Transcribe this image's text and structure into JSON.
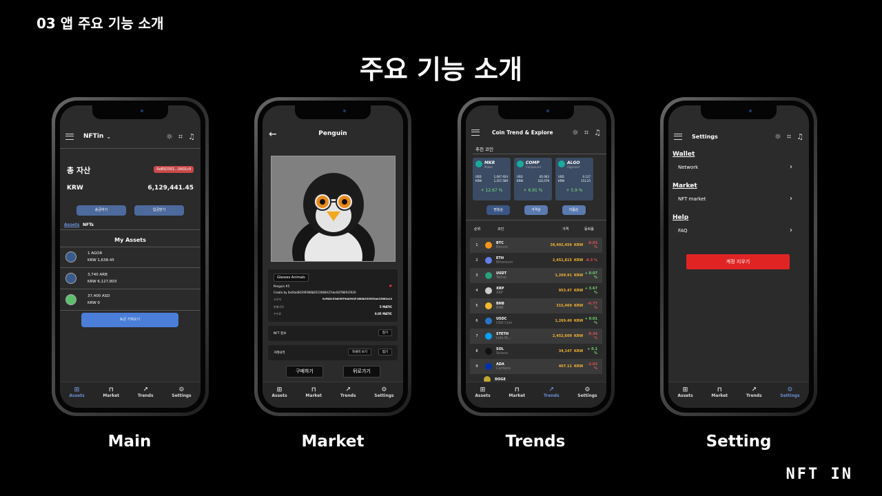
{
  "slide": {
    "section_title": "03 앱 주요 기능 소개",
    "title": "주요 기능 소개",
    "logo": "NFT IN"
  },
  "captions": [
    "Main",
    "Market",
    "Trends",
    "Setting"
  ],
  "tabs": [
    {
      "icon": "wallet-icon",
      "label": "Assets"
    },
    {
      "icon": "bag-icon",
      "label": "Market"
    },
    {
      "icon": "trend-icon",
      "label": "Trends"
    },
    {
      "icon": "gear-icon",
      "label": "Settings"
    }
  ],
  "main": {
    "app_name": "NFTin",
    "total_label": "총 자산",
    "address": "0xB5D301...0A01c9",
    "currency": "KRW",
    "total_value": "6,129,441.45",
    "send_btn": "송금하기",
    "receive_btn": "입금받기",
    "tab_assets": "Assets",
    "tab_nfts": "NFTs",
    "my_assets": "My Assets",
    "assets": [
      {
        "amount": "1 AGOR",
        "krw": "KRW 1,638.45",
        "color": "#3a5a8c"
      },
      {
        "amount": "3,740 ARB",
        "krw": "KRW 6,127,803",
        "color": "#3a5a8c"
      },
      {
        "amount": "37,400 ASD",
        "krw": "KRW 0",
        "color": "#5cbf6a"
      }
    ],
    "import_btn": "토큰 가져오기"
  },
  "market": {
    "title": "Penguin",
    "collection": "Glasses Animals",
    "token": "Penguin #5",
    "creator": "Create by 0x04a4E639F808bE5C0066A37ded3078E91F620",
    "owner_label": "소유자",
    "owner_value": "0xFAD153d059F9dA994F1688b333f3f1b415662a14",
    "price_label": "판매가격",
    "price_value": "5 MATIC",
    "fee_label": "수수료",
    "fee_value": "0.05 MATIC",
    "info_label": "NFT 정보",
    "fold": "접기",
    "history_label": "거래내역",
    "detail": "자세히 보기",
    "buy": "구매하기",
    "back": "뒤로가기"
  },
  "trends": {
    "title": "Coin Trend & Explore",
    "recommend": "추천 코인",
    "cards": [
      {
        "sym": "MKR",
        "name": "Maker",
        "usd": "1,047.924",
        "krw": "1,257,589",
        "chg": "+ 12.67 %"
      },
      {
        "sym": "COMP",
        "name": "Compound",
        "usd": "85.063",
        "krw": "102,076",
        "chg": "+ 6.91 %"
      },
      {
        "sym": "ALGO",
        "name": "Algorand",
        "usd": "0.127",
        "krw": "153.25",
        "chg": "+ 5.9 %"
      }
    ],
    "usd_label": "USD",
    "krw_label": "KRW",
    "sort": [
      "명칭순",
      "가격순",
      "이름순"
    ],
    "cols": [
      "순위",
      "코인",
      "가격",
      "등락률"
    ],
    "coins": [
      {
        "rank": "1",
        "sym": "BTC",
        "name": "Bitcoin",
        "price": "38,492,456",
        "chg": "-0.03 %",
        "up": false,
        "color": "#f7931a"
      },
      {
        "rank": "2",
        "sym": "ETH",
        "name": "Ethereum",
        "price": "2,451,815",
        "chg": "-0.3 %",
        "up": false,
        "color": "#627eea"
      },
      {
        "rank": "3",
        "sym": "USDT",
        "name": "Tether",
        "price": "1,269.91",
        "chg": "+ 0.07 %",
        "up": true,
        "color": "#26a17b"
      },
      {
        "rank": "4",
        "sym": "XRP",
        "name": "XRP",
        "price": "953.47",
        "chg": "+ 3.67 %",
        "up": true,
        "color": "#cccccc"
      },
      {
        "rank": "5",
        "sym": "BNB",
        "name": "BNB",
        "price": "315,469",
        "chg": "-0.77 %",
        "up": false,
        "color": "#f3ba2f"
      },
      {
        "rank": "6",
        "sym": "USDC",
        "name": "USD Coin",
        "price": "1,269.40",
        "chg": "+ 0.01 %",
        "up": true,
        "color": "#2775ca"
      },
      {
        "rank": "7",
        "sym": "STETH",
        "name": "Lido St...",
        "price": "2,452,609",
        "chg": "-0.34 %",
        "up": false,
        "color": "#00a3ff"
      },
      {
        "rank": "8",
        "sym": "SOL",
        "name": "Solana",
        "price": "34,147",
        "chg": "+ 0.1 %",
        "up": true,
        "color": "#111111"
      },
      {
        "rank": "9",
        "sym": "ADA",
        "name": "Cardano",
        "price": "407.11",
        "chg": "-2.93 %",
        "up": false,
        "color": "#0033ad"
      }
    ],
    "partial": "DOGE",
    "krw": "KRW"
  },
  "settings": {
    "title": "Settings",
    "sections": [
      {
        "header": "Wallet",
        "item": "Network"
      },
      {
        "header": "Market",
        "item": "NFT market"
      },
      {
        "header": "Help",
        "item": "FAQ"
      }
    ],
    "delete": "계정 지우기"
  }
}
